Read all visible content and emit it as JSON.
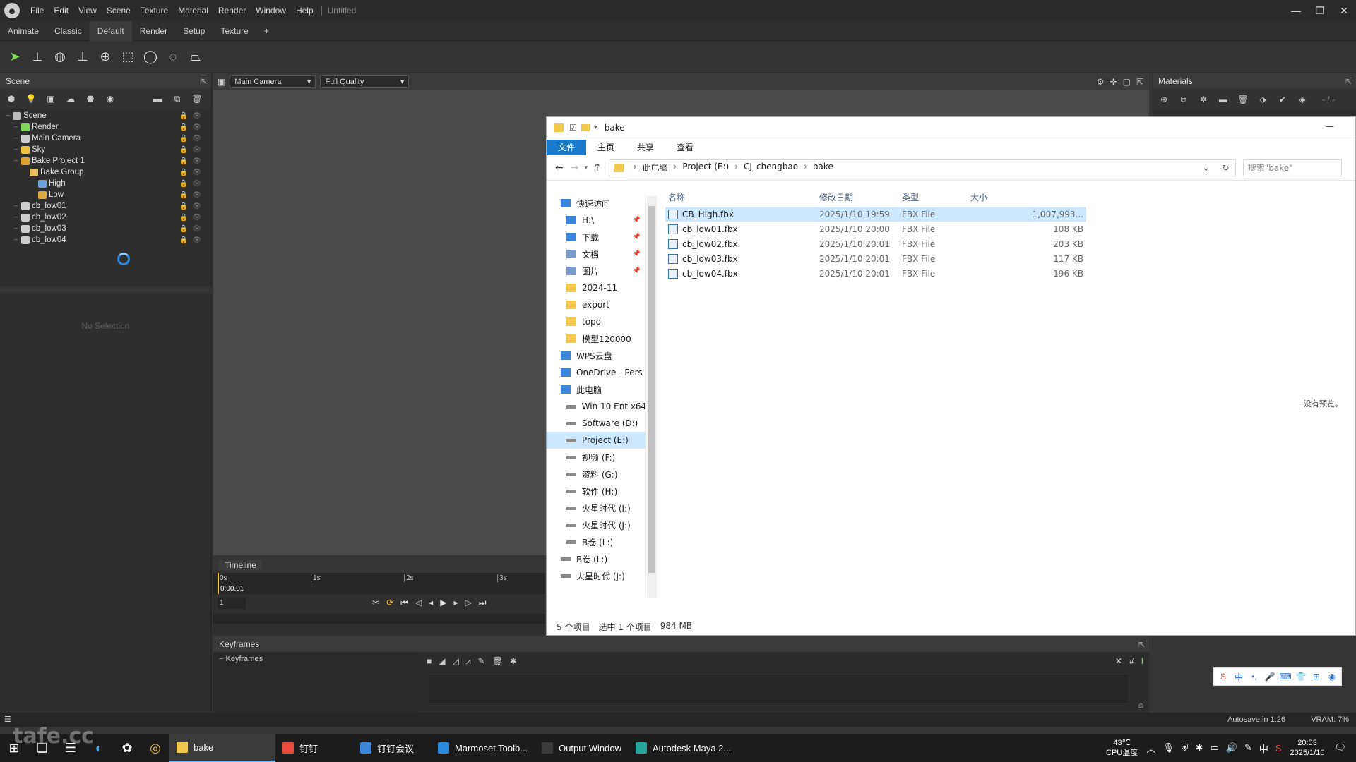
{
  "titlebar": {
    "menus": [
      "File",
      "Edit",
      "View",
      "Scene",
      "Texture",
      "Material",
      "Render",
      "Window",
      "Help"
    ],
    "document": "Untitled"
  },
  "layout_tabs": [
    "Animate",
    "Classic",
    "Default",
    "Render",
    "Setup",
    "Texture",
    "+"
  ],
  "layout_active": "Default",
  "scene": {
    "title": "Scene",
    "tree": [
      {
        "label": "Scene",
        "depth": 0,
        "color": "#bbbbbb"
      },
      {
        "label": "Render",
        "depth": 1,
        "color": "#7ed957"
      },
      {
        "label": "Main Camera",
        "depth": 1,
        "color": "#cccccc"
      },
      {
        "label": "Sky",
        "depth": 1,
        "color": "#f0c040"
      },
      {
        "label": "Bake Project 1",
        "depth": 1,
        "color": "#e0a030"
      },
      {
        "label": "Bake Group",
        "depth": 2,
        "color": "#e8c060"
      },
      {
        "label": "High",
        "depth": 3,
        "color": "#6aa0e0"
      },
      {
        "label": "Low",
        "depth": 3,
        "color": "#d9a840"
      },
      {
        "label": "cb_low01",
        "depth": 1,
        "color": "#cccccc"
      },
      {
        "label": "cb_low02",
        "depth": 1,
        "color": "#cccccc"
      },
      {
        "label": "cb_low03",
        "depth": 1,
        "color": "#cccccc"
      },
      {
        "label": "cb_low04",
        "depth": 1,
        "color": "#cccccc"
      }
    ],
    "no_selection": "No Selection"
  },
  "viewport": {
    "camera": "Main Camera",
    "quality": "Full Quality"
  },
  "materials": {
    "title": "Materials",
    "counter": "- / -"
  },
  "timeline": {
    "title": "Timeline",
    "ticks": [
      "0s",
      "1s",
      "2s",
      "3s"
    ],
    "time": "0:00.01",
    "frame": "1"
  },
  "keyframes": {
    "title": "Keyframes",
    "track": "Keyframes"
  },
  "statusbar": {
    "autosave": "Autosave in 1:26",
    "vram": "VRAM: 7%"
  },
  "explorer": {
    "title": "bake",
    "ribbon": [
      "文件",
      "主页",
      "共享",
      "查看"
    ],
    "path": [
      "此电脑",
      "Project (E:)",
      "CJ_chengbao",
      "bake"
    ],
    "search_placeholder": "搜索\"bake\"",
    "columns": {
      "name": "名称",
      "date": "修改日期",
      "type": "类型",
      "size": "大小"
    },
    "files": [
      {
        "name": "CB_High.fbx",
        "date": "2025/1/10 19:59",
        "type": "FBX File",
        "size": "1,007,993..."
      },
      {
        "name": "cb_low01.fbx",
        "date": "2025/1/10 20:00",
        "type": "FBX File",
        "size": "108 KB"
      },
      {
        "name": "cb_low02.fbx",
        "date": "2025/1/10 20:01",
        "type": "FBX File",
        "size": "203 KB"
      },
      {
        "name": "cb_low03.fbx",
        "date": "2025/1/10 20:01",
        "type": "FBX File",
        "size": "117 KB"
      },
      {
        "name": "cb_low04.fbx",
        "date": "2025/1/10 20:01",
        "type": "FBX File",
        "size": "196 KB"
      }
    ],
    "nav": [
      {
        "label": "快速访问",
        "type": "star",
        "indent": 1
      },
      {
        "label": "H:\\",
        "type": "drive-blue",
        "indent": 2,
        "pin": true
      },
      {
        "label": "下载",
        "type": "download",
        "indent": 2,
        "pin": true
      },
      {
        "label": "文档",
        "type": "doc",
        "indent": 2,
        "pin": true
      },
      {
        "label": "图片",
        "type": "pic",
        "indent": 2,
        "pin": true
      },
      {
        "label": "2024-11",
        "type": "folder",
        "indent": 2
      },
      {
        "label": "export",
        "type": "folder",
        "indent": 2
      },
      {
        "label": "topo",
        "type": "folder",
        "indent": 2
      },
      {
        "label": "模型120000",
        "type": "folder",
        "indent": 2
      },
      {
        "label": "WPS云盘",
        "type": "cloud",
        "indent": 1
      },
      {
        "label": "OneDrive - Pers",
        "type": "cloud",
        "indent": 1
      },
      {
        "label": "此电脑",
        "type": "pc",
        "indent": 1
      },
      {
        "label": "Win 10 Ent x64",
        "type": "drive",
        "indent": 2
      },
      {
        "label": "Software (D:)",
        "type": "drive",
        "indent": 2
      },
      {
        "label": "Project (E:)",
        "type": "drive",
        "indent": 2,
        "selected": true
      },
      {
        "label": "视频 (F:)",
        "type": "drive",
        "indent": 2
      },
      {
        "label": "资料 (G:)",
        "type": "drive",
        "indent": 2
      },
      {
        "label": "软件 (H:)",
        "type": "drive",
        "indent": 2
      },
      {
        "label": "火星时代 (I:)",
        "type": "drive",
        "indent": 2
      },
      {
        "label": "火星时代 (J:)",
        "type": "drive",
        "indent": 2
      },
      {
        "label": "B卷 (L:)",
        "type": "drive",
        "indent": 2
      },
      {
        "label": "B卷 (L:)",
        "type": "drive",
        "indent": 1
      },
      {
        "label": "火星时代 (J:)",
        "type": "drive",
        "indent": 1
      }
    ],
    "status_count": "5 个项目",
    "status_selected": "选中 1 个项目",
    "status_size": "984 MB",
    "no_preview": "没有预览。"
  },
  "taskbar": {
    "apps": [
      {
        "label": "bake",
        "active": true
      },
      {
        "label": "钉钉"
      },
      {
        "label": "钉钉会议"
      },
      {
        "label": "Marmoset Toolb..."
      },
      {
        "label": "Output Window"
      },
      {
        "label": "Autodesk Maya 2..."
      }
    ],
    "temp": "43℃",
    "temp_label": "CPU温度",
    "ime": "中",
    "time": "20:03",
    "date": "2025/1/10"
  },
  "ime_toolbar": [
    "S",
    "中",
    "•,",
    "🎤",
    "⌨",
    "👕",
    "⊞",
    "◉"
  ],
  "watermark": "tafe.cc"
}
